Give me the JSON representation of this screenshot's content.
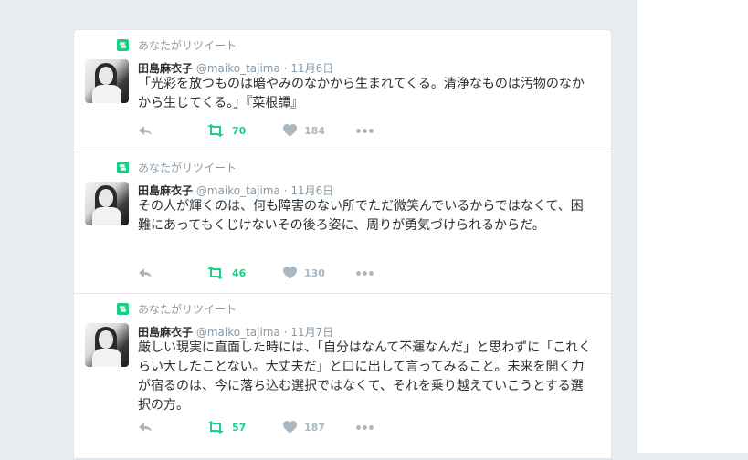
{
  "colors": {
    "retweet_green": "#19cf86",
    "muted": "#8899a6",
    "text": "#292f33",
    "icon_gray": "#aab8c2",
    "border": "#e1e8ed",
    "page_bg": "#e6ecf0"
  },
  "tweets": [
    {
      "retweet_context": "あなたがリツイート",
      "name": "田島麻衣子",
      "username": "@maiko_tajima",
      "separator": "·",
      "time": "11月6日",
      "text": "「光彩を放つものは暗やみのなかから生まれてくる。清浄なものは汚物のなかから生じてくる。」『菜根譚』",
      "retweets": "70",
      "likes": "184"
    },
    {
      "retweet_context": "あなたがリツイート",
      "name": "田島麻衣子",
      "username": "@maiko_tajima",
      "separator": "·",
      "time": "11月6日",
      "text": "その人が輝くのは、何も障害のない所でただ微笑んでいるからではなくて、困難にあってもくじけないその後ろ姿に、周りが勇気づけられるからだ。",
      "retweets": "46",
      "likes": "130"
    },
    {
      "retweet_context": "あなたがリツイート",
      "name": "田島麻衣子",
      "username": "@maiko_tajima",
      "separator": "·",
      "time": "11月7日",
      "text": "厳しい現実に直面した時には、「自分はなんて不運なんだ」と思わずに「これくらい大したことない。大丈夫だ」と口に出して言ってみること。未来を開く力が宿るのは、今に落ち込む選択ではなくて、それを乗り越えていこうとする選択の方。",
      "retweets": "57",
      "likes": "187"
    }
  ]
}
